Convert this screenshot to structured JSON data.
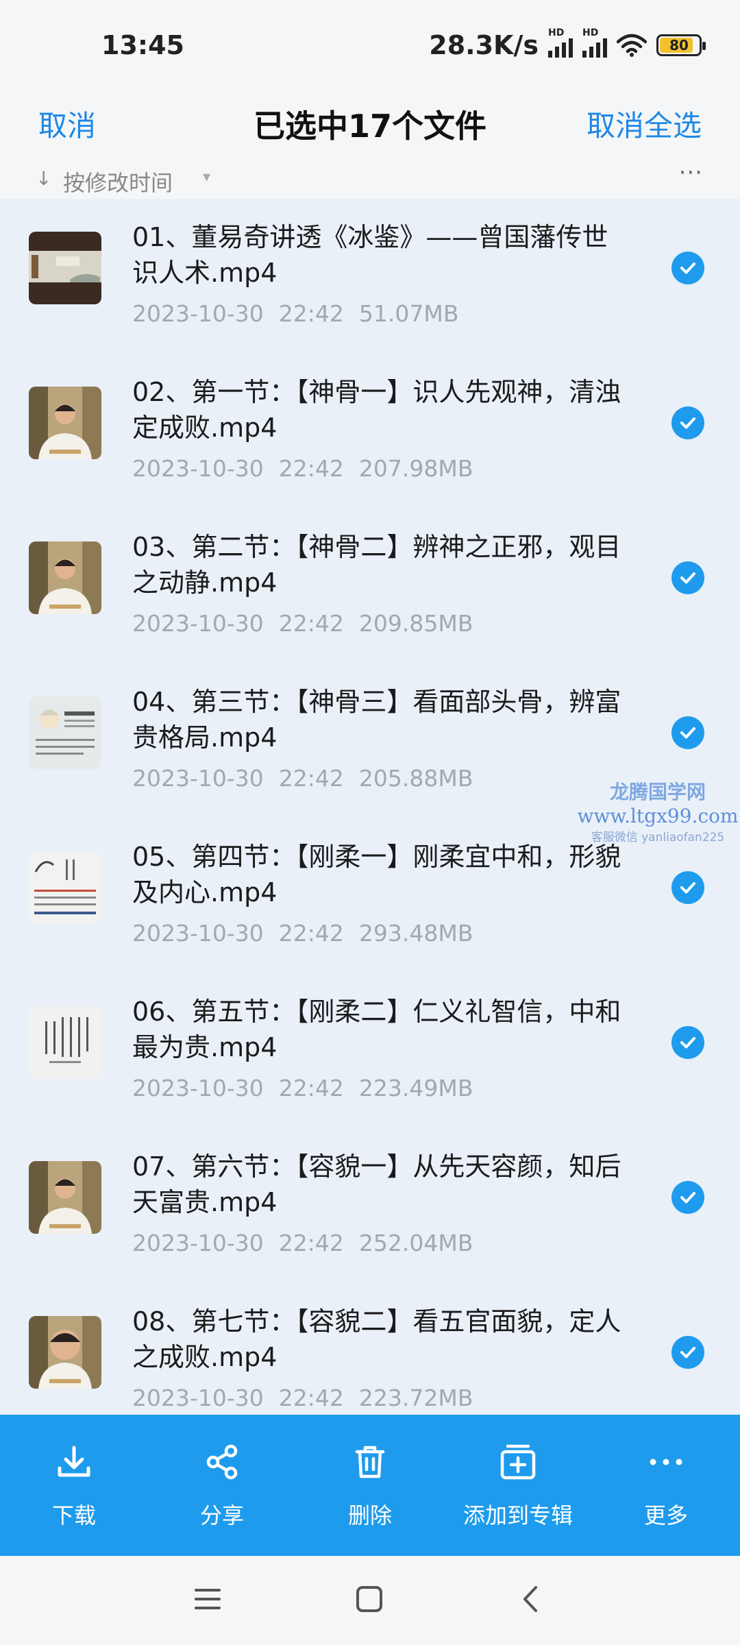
{
  "status_bar": {
    "time": "13:45",
    "net_speed": "28.3K/s",
    "signal_labels": [
      "HD",
      "HD"
    ],
    "battery": "80"
  },
  "header": {
    "cancel_label": "取消",
    "title": "已选中17个文件",
    "deselect_all_label": "取消全选"
  },
  "sort_bar": {
    "label": "按修改时间"
  },
  "files": [
    {
      "name": "01、董易奇讲透《冰鉴》——曾国藩传世识人术.mp4",
      "date": "2023-10-30",
      "time": "22:42",
      "size": "51.07MB",
      "thumb": "scroll-painting",
      "selected": true
    },
    {
      "name": "02、第一节：【神骨一】识人先观神，清浊定成败.mp4",
      "date": "2023-10-30",
      "time": "22:42",
      "size": "207.98MB",
      "thumb": "lecturer",
      "selected": true
    },
    {
      "name": "03、第二节：【神骨二】辨神之正邪，观目之动静.mp4",
      "date": "2023-10-30",
      "time": "22:42",
      "size": "209.85MB",
      "thumb": "lecturer",
      "selected": true
    },
    {
      "name": "04、第三节：【神骨三】看面部头骨，辨富贵格局.mp4",
      "date": "2023-10-30",
      "time": "22:42",
      "size": "205.88MB",
      "thumb": "face-chart",
      "selected": true
    },
    {
      "name": "05、第四节：【刚柔一】刚柔宜中和，形貌及内心.mp4",
      "date": "2023-10-30",
      "time": "22:42",
      "size": "293.48MB",
      "thumb": "ink-text",
      "selected": true
    },
    {
      "name": "06、第五节：【刚柔二】仁义礼智信，中和最为贵.mp4",
      "date": "2023-10-30",
      "time": "22:42",
      "size": "223.49MB",
      "thumb": "calligraphy",
      "selected": true
    },
    {
      "name": "07、第六节：【容貌一】从先天容颜，知后天富贵.mp4",
      "date": "2023-10-30",
      "time": "22:42",
      "size": "252.04MB",
      "thumb": "lecturer",
      "selected": true
    },
    {
      "name": "08、第七节：【容貌二】看五官面貌，定人之成败.mp4",
      "date": "2023-10-30",
      "time": "22:42",
      "size": "223.72MB",
      "thumb": "lecturer-close",
      "selected": true
    }
  ],
  "watermark": {
    "line1": "龙腾国学网",
    "line2": "www.ltgx99.com",
    "line3": "客服微信 yanliaofan225"
  },
  "actions": [
    {
      "label": "下载",
      "icon": "download-icon"
    },
    {
      "label": "分享",
      "icon": "share-icon"
    },
    {
      "label": "删除",
      "icon": "trash-icon"
    },
    {
      "label": "添加到专辑",
      "icon": "add-to-album-icon"
    },
    {
      "label": "更多",
      "icon": "more-icon"
    }
  ],
  "nav": {
    "icons": [
      "menu-icon",
      "home-icon",
      "back-icon"
    ]
  },
  "colors": {
    "accent": "#1e9bec",
    "link": "#1e88e5",
    "background": "#e9f0f8"
  }
}
